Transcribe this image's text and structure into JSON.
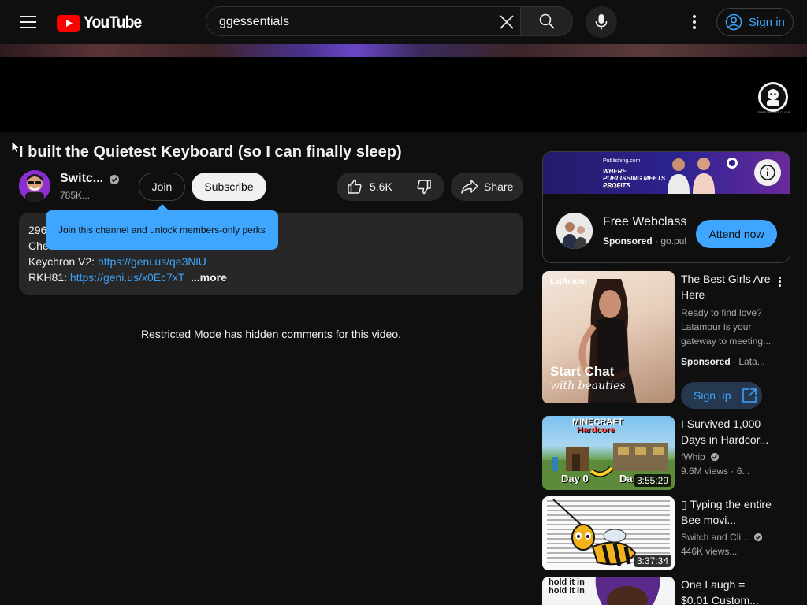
{
  "header": {
    "logo_text": "YouTube",
    "search_value": "ggessentials",
    "signin_label": "Sign in"
  },
  "player": {
    "watermark_caption": "SWITCH AND CLICK"
  },
  "video": {
    "title": "I built the Quietest Keyboard (so I can finally sleep)",
    "channel_name": "Switc...",
    "subscribers": "785K...",
    "join_label": "Join",
    "subscribe_label": "Subscribe",
    "likes": "5.6K",
    "share_label": "Share"
  },
  "description": {
    "line1": "296",
    "line2": "Chec",
    "line3_label": "Keychron V2: ",
    "line3_link": "https://geni.us/qe3NlU",
    "line4_label": "RKH81: ",
    "line4_link": "https://geni.us/x0Ec7xT",
    "more_label": "...more"
  },
  "tooltip": {
    "text": "Join this channel and unlock members-only perks"
  },
  "comments": {
    "restricted_text": "Restricted Mode has hidden comments for this video."
  },
  "ad": {
    "banner_brand": "Publishing.com",
    "banner_title": "WHERE PUBLISHING MEETS PROFITS",
    "banner_stars": "★★★★★",
    "title": "Free Webclass",
    "sponsored": "Sponsored",
    "domain": "go.pul",
    "cta": "Attend now"
  },
  "recommendations": [
    {
      "title": "The Best Girls Are Here",
      "desc": "Ready to find love? Latamour is your gateway to meeting...",
      "sponsored": "Sponsored",
      "advertiser": "Lata...",
      "cta": "Sign up",
      "thumb_brand": "LatAmour",
      "thumb_line1": "Start Chat",
      "thumb_line2": "with beauties"
    },
    {
      "title": "I Survived 1,000 Days in Hardcor...",
      "channel": "fWhip",
      "stats": "9.6M views",
      "stats_extra": "6...",
      "duration": "3:55:29",
      "thumb_top1": "MINECRAFT",
      "thumb_top2": "Hardcore",
      "thumb_left": "Day 0",
      "thumb_right": "Da"
    },
    {
      "title": "▯ Typing the entire Bee movi...",
      "channel": "Switch and Cli...",
      "stats": "446K views...",
      "duration": "3:37:34"
    },
    {
      "title": "One Laugh = $0.01 Custom...",
      "thumb_text": "hold it in hold it in"
    }
  ],
  "colors": {
    "background": "#0f0f0f",
    "accent_blue": "#3ea6ff",
    "youtube_red": "#ff0000",
    "chip_bg": "#272727"
  }
}
